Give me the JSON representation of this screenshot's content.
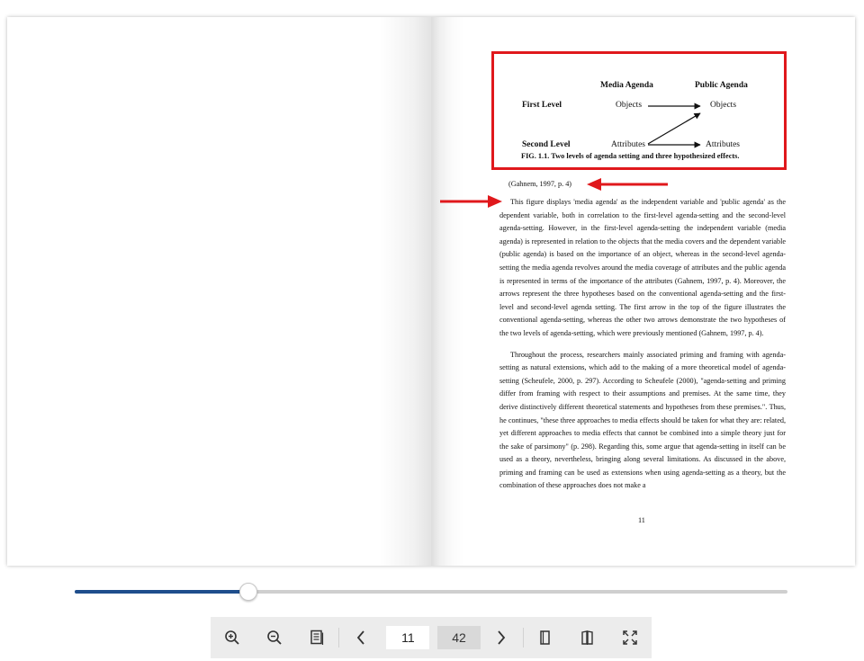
{
  "viewer": {
    "current_page": "11",
    "total_pages": "42",
    "progress_fraction": 0.244,
    "toolbar": {
      "zoom_in": "zoom-in-icon",
      "zoom_out": "zoom-out-icon",
      "table_of_contents": "document-icon",
      "previous_page": "chevron-left-icon",
      "next_page": "chevron-right-icon",
      "single_page": "single-page-icon",
      "double_page": "double-page-icon",
      "fullscreen": "fullscreen-icon"
    },
    "highlight_color": "#e0181c",
    "slider_color": "#1f4e8c"
  },
  "figure": {
    "header_media": "Media Agenda",
    "header_public": "Public Agenda",
    "row1_label": "First Level",
    "row1_media": "Objects",
    "row1_public": "Objects",
    "row2_label": "Second Level",
    "row2_media": "Attributes",
    "row2_public": "Attributes",
    "caption": "FIG. 1.1.  Two levels of agenda setting and three hypothesized effects."
  },
  "document": {
    "citation": "(Gahnem, 1997, p. 4)",
    "paragraph1": "This figure displays 'media agenda' as the independent variable and 'public agenda' as the dependent variable, both in correlation to the first-level agenda-setting and the second-level agenda-setting. However, in the first-level agenda-setting the independent variable (media agenda) is represented in relation to the objects that the media covers and the dependent variable (public agenda) is based on the importance of an object, whereas in the second-level agenda-setting the media agenda revolves around the media coverage of attributes and the public agenda is represented in terms of the importance of the attributes (Gahnem, 1997, p. 4). Moreover, the arrows represent the three hypotheses based on the conventional agenda-setting and the first-level and second-level agenda setting. The first arrow in the top of the figure illustrates the conventional agenda-setting, whereas the other two arrows demonstrate the two hypotheses of the two levels of agenda-setting, which were previously mentioned (Gahnem, 1997, p. 4).",
    "paragraph2": "Throughout the process, researchers mainly associated priming and framing with agenda-setting as natural extensions, which add to the making of a more theoretical model of agenda-setting (Scheufele, 2000, p. 297). According to Scheufele (2000), \"agenda-setting and priming differ from framing with respect to their assumptions and premises. At the same time, they derive distinctively different theoretical statements and hypotheses from these premises.\". Thus, he continues, \"these three approaches to media effects should be taken for what they are: related, yet different approaches to media effects that cannot be combined into a simple theory just for the sake of parsimony\" (p. 298). Regarding this, some argue that agenda-setting in itself can be used as a theory, nevertheless, bringing along several limitations. As discussed in the above, priming and framing can be used as extensions when using agenda-setting as a theory, but the combination of these approaches does not make a",
    "page_number": "11"
  }
}
